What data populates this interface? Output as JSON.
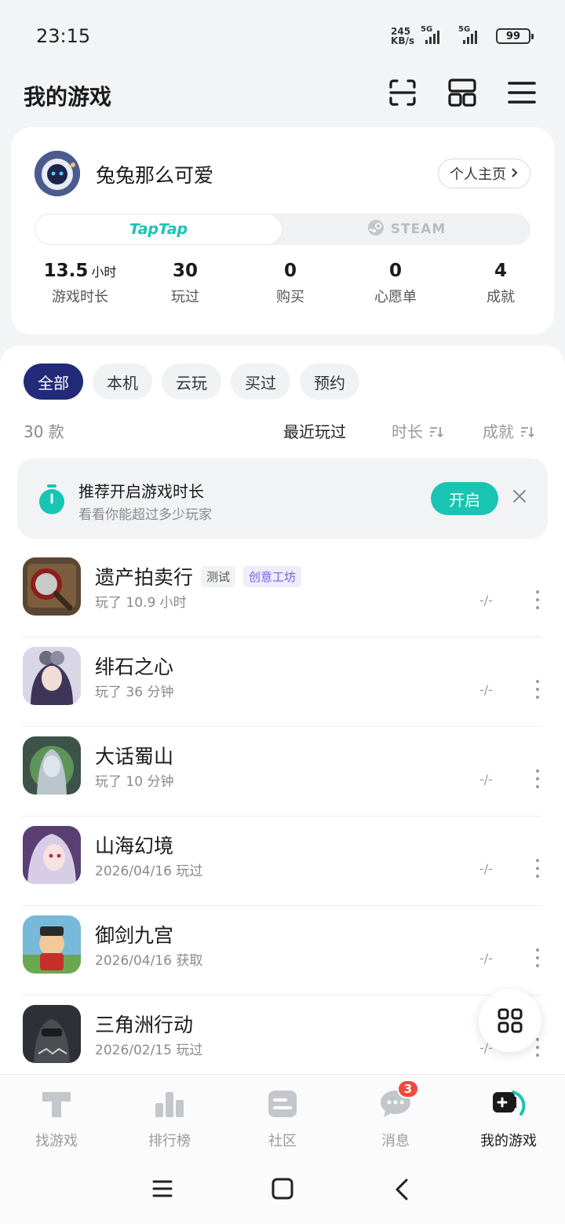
{
  "status_bar": {
    "time": "23:15",
    "net_speed_value": "245",
    "net_speed_unit": "KB/s",
    "signal1_label": "5G",
    "signal2_label": "5G",
    "battery": "99"
  },
  "header": {
    "title": "我的游戏",
    "icons": [
      "scan-icon",
      "layout-icon",
      "menu-icon"
    ]
  },
  "profile": {
    "username": "兔兔那么可爱",
    "profile_button": "个人主页",
    "platform_tabs": [
      "TapTap",
      "STEAM"
    ],
    "active_platform": "TapTap",
    "stats": [
      {
        "value": "13.5",
        "unit": "小时",
        "label": "游戏时长"
      },
      {
        "value": "30",
        "unit": "",
        "label": "玩过"
      },
      {
        "value": "0",
        "unit": "",
        "label": "购买"
      },
      {
        "value": "0",
        "unit": "",
        "label": "心愿单"
      },
      {
        "value": "4",
        "unit": "",
        "label": "成就"
      }
    ]
  },
  "filters": {
    "chips": [
      "全部",
      "本机",
      "云玩",
      "买过",
      "预约"
    ],
    "active": "全部"
  },
  "sort": {
    "count": "30 款",
    "recent": "最近玩过",
    "duration": "时长",
    "achievement": "成就"
  },
  "recommend": {
    "title": "推荐开启游戏时长",
    "subtitle": "看看你能超过多少玩家",
    "button": "开启"
  },
  "games": [
    {
      "title": "遗产拍卖行",
      "tags": [
        "测试",
        "创意工坊"
      ],
      "sub": "玩了 10.9 小时",
      "score": "-/-"
    },
    {
      "title": "绯石之心",
      "tags": [],
      "sub": "玩了 36 分钟",
      "score": "-/-"
    },
    {
      "title": "大话蜀山",
      "tags": [],
      "sub": "玩了 10 分钟",
      "score": "-/-"
    },
    {
      "title": "山海幻境",
      "tags": [],
      "sub": "2026/04/16 玩过",
      "score": "-/-"
    },
    {
      "title": "御剑九宫",
      "tags": [],
      "sub": "2026/04/16 获取",
      "score": "-/-"
    },
    {
      "title": "三角洲行动",
      "tags": [],
      "sub": "2026/02/15 玩过",
      "score": "-/-"
    }
  ],
  "bottom_nav": {
    "items": [
      "找游戏",
      "排行榜",
      "社区",
      "消息",
      "我的游戏"
    ],
    "active": "我的游戏",
    "message_badge": "3"
  },
  "colors": {
    "accent_teal": "#19c4b3",
    "active_chip": "#232a7a",
    "badge_red": "#f04a3b",
    "tag_purple": "#7b5ae0"
  }
}
